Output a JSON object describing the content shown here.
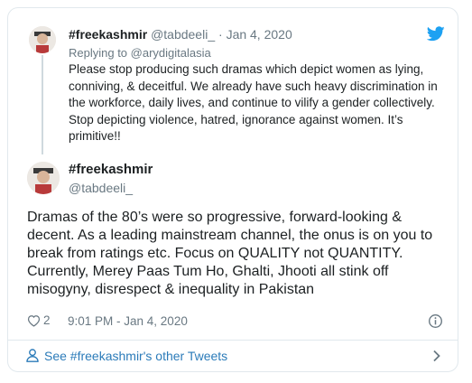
{
  "parent_tweet": {
    "display_name": "#freekashmir",
    "handle": "@tabdeeli_",
    "separator": "·",
    "date": "Jan 4, 2020",
    "replying_to_prefix": "Replying to",
    "replying_to_handle": "@arydigitalasia",
    "text": "Please stop producing such dramas which depict women as lying, conniving, & deceitful. We already have such heavy discrimination in the workforce, daily lives, and continue to vilify a gender collectively. Stop depicting violence, hatred, ignorance against women. It’s primitive!!"
  },
  "main_tweet": {
    "display_name": "#freekashmir",
    "handle": "@tabdeeli_",
    "text": "Dramas of the 80’s were so progressive, forward-looking & decent. As a leading mainstream channel, the onus is on you to break from ratings etc. Focus on QUALITY not QUANTITY. Currently, Merey Paas Tum Ho, Ghalti, Jhooti all stink off misogyny, disrespect & inequality in Pakistan",
    "like_count": "2",
    "timestamp": "9:01 PM - Jan 4, 2020"
  },
  "footer": {
    "other_tweets_label": "See #freekashmir's other Tweets"
  },
  "icons": {
    "brand": "twitter-bird-icon",
    "like": "heart-icon",
    "info": "info-icon",
    "profile": "person-icon",
    "chevron": "chevron-right-icon"
  },
  "colors": {
    "twitter_blue": "#1da1f2",
    "link_blue": "#2b7bb9",
    "secondary_text": "#697882",
    "border": "#e1e8ed"
  }
}
